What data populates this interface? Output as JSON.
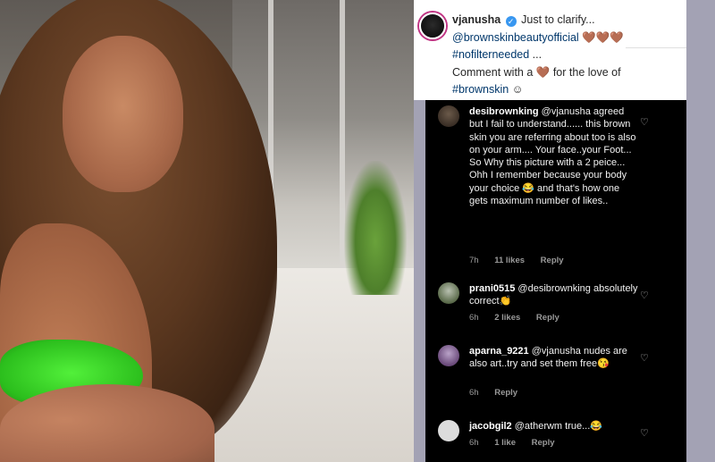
{
  "post": {
    "username": "vjanusha",
    "verified_icon": "verified-badge-icon",
    "caption_line1": "Just to clarify...",
    "mention": "@brownskinbeautyofficial",
    "hearts": "🤎🤎🤎",
    "hashtag1": "#nofilterneeded",
    "ellipsis": " ...",
    "caption_line3_pre": "Comment with a ",
    "caption_heart": "🤎",
    "caption_line3_post": " for the love of",
    "hashtag2": "#brownskin",
    "smile": " ☺"
  },
  "comments": [
    {
      "username": "desibrownking",
      "text": " @vjanusha agreed but I fail to understand...... this brown skin you are referring about too is also on your arm.... Your face..your Foot... So Why this picture with a 2 peice... Ohh I remember because your body your choice 😂 and that's how one gets maximum number of likes..",
      "time": "7h",
      "likes": "11 likes",
      "reply": "Reply"
    },
    {
      "username": "prani0515",
      "text": " @desibrownking absolutely correct👏",
      "time": "6h",
      "likes": "2 likes",
      "reply": "Reply"
    },
    {
      "username": "aparna_9221",
      "text": " @vjanusha nudes are also art..try and set them free😘",
      "time": "6h",
      "likes": "",
      "reply": "Reply"
    },
    {
      "username": "jacobgil2",
      "text": " @atherwm true...😂",
      "time": "6h",
      "likes": "1 like",
      "reply": "Reply"
    }
  ],
  "icons": {
    "heart": "♡"
  },
  "colors": {
    "link": "#00376b",
    "verified": "#3897f0",
    "comment_bg": "#000000",
    "page_bg": "#a3a2b4"
  }
}
